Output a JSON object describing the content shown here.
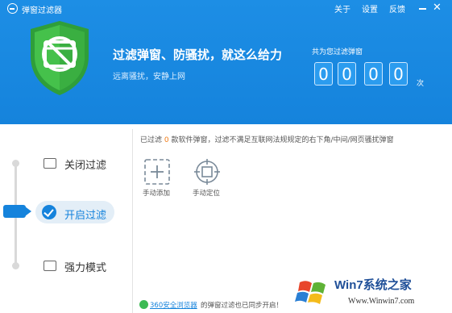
{
  "app": {
    "title": "弹窗过滤器"
  },
  "menu": {
    "about": "关于",
    "settings": "设置",
    "feedback": "反馈"
  },
  "header": {
    "headline": "过滤弹窗、防骚扰，就这么给力",
    "subline": "远离骚扰，安静上网",
    "count_label": "共为您过滤弹窗",
    "digits": [
      "0",
      "0",
      "0",
      "0"
    ],
    "count_unit": "次"
  },
  "modes": {
    "off": "关闭过滤",
    "on": "开启过滤",
    "strong": "强力模式",
    "selected": "on"
  },
  "info": {
    "prefix": "已过滤",
    "count": "0",
    "suffix": "款软件弹窗，过滤不满足互联网法规规定的右下角/中间/网页骚扰弹窗"
  },
  "tools": {
    "manual_add": "手动添加",
    "manual_locate": "手动定位"
  },
  "footer": {
    "link": "360安全浏览器",
    "text": "的弹窗过滤也已同步开启！"
  },
  "watermark": {
    "brand": "Win7系统之家",
    "url": "Www.Winwin7.com"
  },
  "colors": {
    "header_blue": "#1583dc",
    "shield_green": "#3cb43c",
    "count_orange": "#f07a14"
  }
}
